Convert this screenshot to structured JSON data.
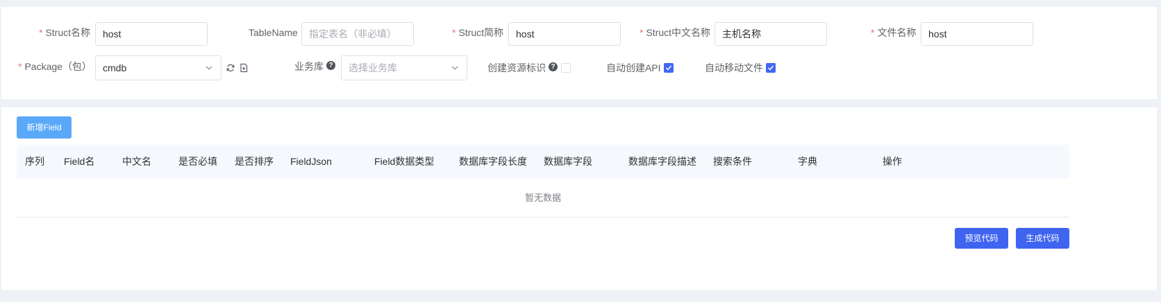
{
  "form": {
    "struct_name_label": "Struct名称",
    "struct_name_value": "host",
    "table_name_label": "TableName",
    "table_name_placeholder": "指定表名（非必填）",
    "struct_abbr_label": "Struct简称",
    "struct_abbr_value": "host",
    "struct_cn_label": "Struct中文名称",
    "struct_cn_value": "主机名称",
    "file_name_label": "文件名称",
    "file_name_value": "host",
    "package_label": "Package（包）",
    "package_value": "cmdb",
    "business_db_label": "业务库",
    "business_db_placeholder": "选择业务库",
    "create_resource_label": "创建资源标识",
    "auto_api_label": "自动创建API",
    "auto_move_label": "自动移动文件",
    "required_mark": "*",
    "help_mark": "?"
  },
  "toggles": {
    "create_resource": false,
    "auto_api": true,
    "auto_move": true
  },
  "table": {
    "add_field_label": "新增Field",
    "columns": [
      "序列",
      "Field名",
      "中文名",
      "是否必填",
      "是否排序",
      "FieldJson",
      "Field数据类型",
      "数据库字段长度",
      "数据库字段",
      "数据库字段描述",
      "搜索条件",
      "字典",
      "操作"
    ],
    "empty_text": "暂无数据"
  },
  "actions": {
    "preview_label": "预览代码",
    "generate_label": "生成代码"
  },
  "colors": {
    "primary": "#3f64f0",
    "light_button": "#5aa9f8",
    "required": "#f56c6c"
  }
}
